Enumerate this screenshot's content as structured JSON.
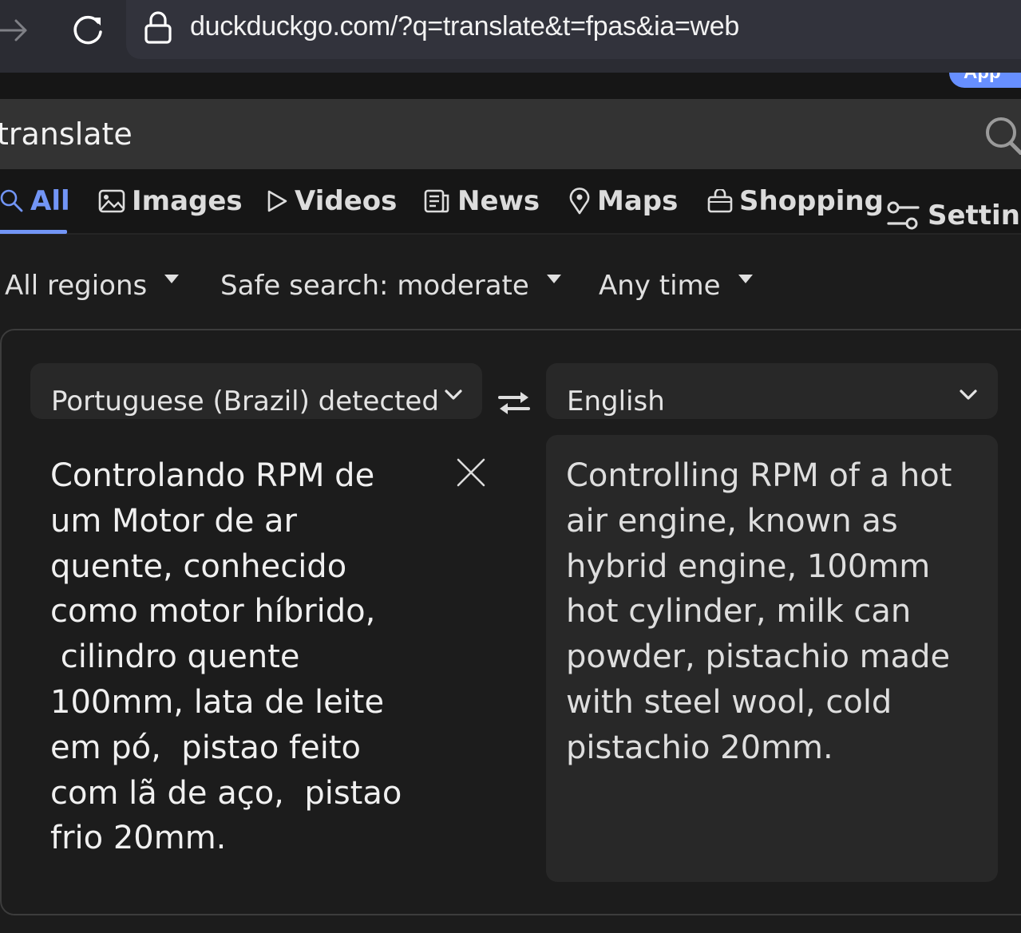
{
  "browser": {
    "url": "duckduckgo.com/?q=translate&t=fpas&ia=web",
    "forward_icon": "arrow-right-icon",
    "reload_icon": "reload-icon",
    "lock_icon": "lock-icon"
  },
  "header": {
    "app_badge_label": "App",
    "app_badge_color": "#678fff"
  },
  "search": {
    "query": "translate",
    "icon": "search-icon"
  },
  "tabs": [
    {
      "label": "All",
      "icon": "search-icon",
      "active": true
    },
    {
      "label": "Images",
      "icon": "image-icon",
      "active": false
    },
    {
      "label": "Videos",
      "icon": "play-icon",
      "active": false
    },
    {
      "label": "News",
      "icon": "newspaper-icon",
      "active": false
    },
    {
      "label": "Maps",
      "icon": "map-pin-icon",
      "active": false
    },
    {
      "label": "Shopping",
      "icon": "shopping-bag-icon",
      "active": false
    },
    {
      "label": "Settings",
      "icon": "sliders-icon",
      "active": false
    }
  ],
  "accent_color": "#7295f6",
  "filters": {
    "region": "All regions",
    "safe_search": "Safe search: moderate",
    "time": "Any time"
  },
  "translator": {
    "source_language": "Portuguese (Brazil) detected",
    "target_language": "English",
    "swap_icon": "swap-arrows-icon",
    "clear_icon": "close-icon",
    "source_text": "Controlando RPM de\num Motor de ar\nquente, conhecido\ncomo motor híbrido,\n cilindro quente\n100mm, lata de leite\nem pó,  pistao feito\ncom lã de aço,  pistao\nfrio 20mm.",
    "translated_text": "Controlling RPM of a hot\nair engine, known as\nhybrid engine, 100mm\nhot cylinder, milk can\npowder, pistachio made\nwith steel wool, cold\npistachio 20mm."
  }
}
